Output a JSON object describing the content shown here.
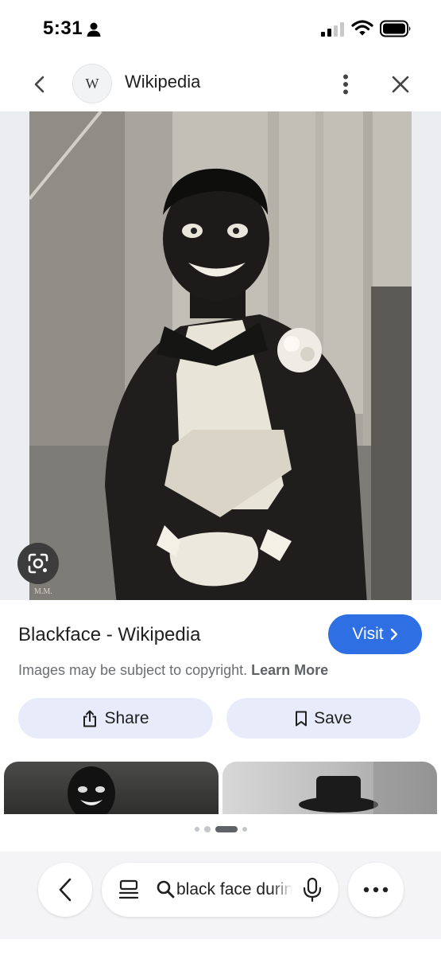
{
  "status_bar": {
    "time": "5:31",
    "icons": [
      "person-icon",
      "signal-icon",
      "wifi-icon",
      "battery-icon"
    ]
  },
  "header": {
    "back_icon": "chevron-left-icon",
    "site_logo_letter": "W",
    "site_name": "Wikipedia",
    "more_icon": "more-vertical-icon",
    "close_icon": "close-icon"
  },
  "image": {
    "caption_mark": "M.M.",
    "lens_icon": "google-lens-icon"
  },
  "result": {
    "title": "Blackface - Wikipedia",
    "visit_label": "Visit",
    "copyright_text": "Images may be subject to copyright.",
    "learn_more_label": "Learn More"
  },
  "actions": {
    "share_label": "Share",
    "save_label": "Save"
  },
  "pager": {
    "count": 5,
    "active_index": 2
  },
  "toolbar": {
    "search_query": "black face during",
    "icons": [
      "chevron-left-icon",
      "tabs-icon",
      "search-icon",
      "mic-icon",
      "more-horizontal-icon"
    ]
  },
  "colors": {
    "accent": "#2f6fe4",
    "pill_bg": "#e8ecfa",
    "image_bg": "#ebedf0"
  }
}
